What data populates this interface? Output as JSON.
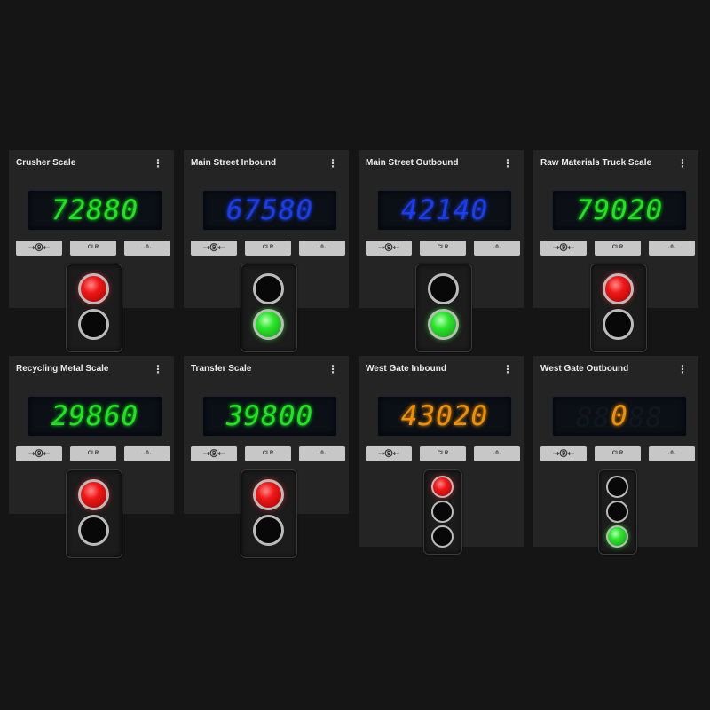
{
  "colors": {
    "background": "#151515",
    "card": "#242424",
    "display_bg": "#0b1017",
    "green_digits": "#1ee61e",
    "blue_digits": "#1a3df0",
    "orange_digits": "#f09000",
    "lamp_red": "#f01818",
    "lamp_green": "#2ee62e"
  },
  "buttons": {
    "print_glyph": "⇢⓽⇠",
    "clear_label": "CLR",
    "zero_label": "→0←"
  },
  "scales": [
    {
      "title": "Crusher Scale",
      "weight": "72880",
      "ghost": "88888",
      "digit_color": "green",
      "lights": [
        "red",
        "off"
      ]
    },
    {
      "title": "Main Street Inbound",
      "weight": "67580",
      "ghost": "88888",
      "digit_color": "blue",
      "lights": [
        "off",
        "green"
      ]
    },
    {
      "title": "Main Street Outbound",
      "weight": "42140",
      "ghost": "88888",
      "digit_color": "blue",
      "lights": [
        "off",
        "green"
      ]
    },
    {
      "title": "Raw Materials Truck Scale",
      "weight": "79020",
      "ghost": "88888",
      "digit_color": "green",
      "lights": [
        "red",
        "off"
      ]
    },
    {
      "title": "Recycling Metal Scale",
      "weight": "29860",
      "ghost": "88888",
      "digit_color": "green",
      "lights": [
        "red",
        "off"
      ]
    },
    {
      "title": "Transfer Scale",
      "weight": "39800",
      "ghost": "88888",
      "digit_color": "green",
      "lights": [
        "red",
        "off"
      ]
    },
    {
      "title": "West Gate Inbound",
      "weight": "43020",
      "ghost": "88888",
      "digit_color": "orange",
      "lights": [
        "red",
        "off",
        "off"
      ]
    },
    {
      "title": "West Gate Outbound",
      "weight": "0",
      "ghost": "88888",
      "digit_color": "orange",
      "lights": [
        "off",
        "off",
        "green"
      ]
    }
  ]
}
